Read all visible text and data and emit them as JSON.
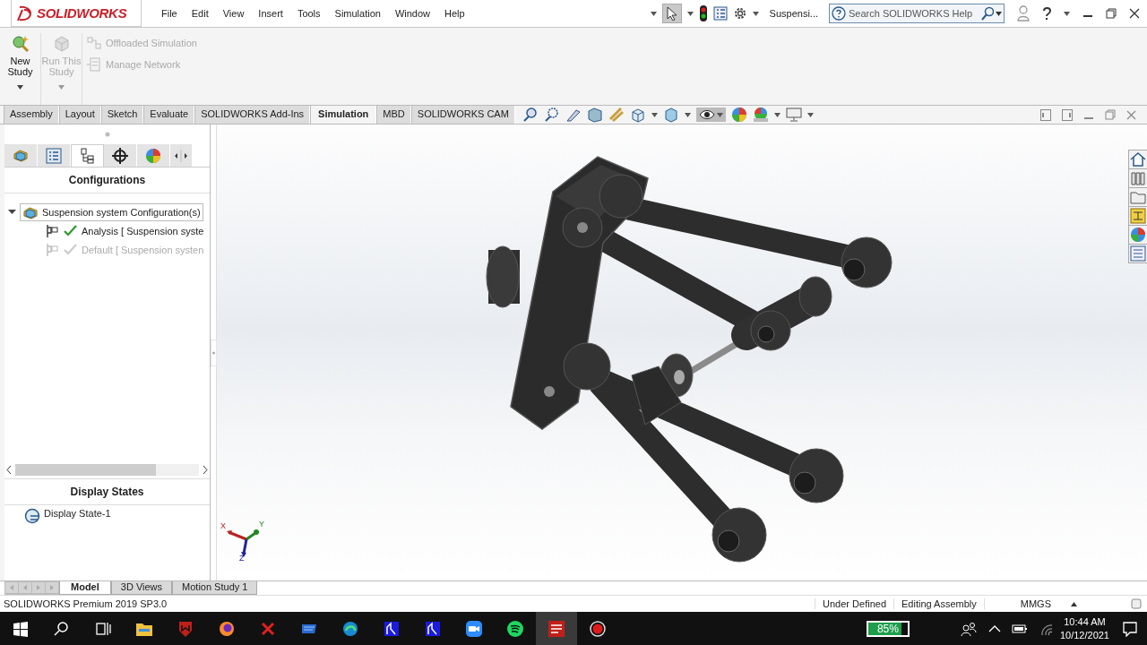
{
  "app": {
    "logo": "SOLIDWORKS"
  },
  "menu": [
    "File",
    "Edit",
    "View",
    "Insert",
    "Tools",
    "Simulation",
    "Window",
    "Help"
  ],
  "document_title": "Suspensi...",
  "search": {
    "placeholder": "Search SOLIDWORKS Help"
  },
  "ribbon": {
    "large_buttons": [
      {
        "label": "New Study",
        "disabled": false
      },
      {
        "label": "Run This Study",
        "disabled": true
      }
    ],
    "small_buttons": [
      {
        "label": "Offloaded Simulation",
        "disabled": true
      },
      {
        "label": "Manage Network",
        "disabled": true
      }
    ]
  },
  "command_tabs": [
    {
      "label": "Assembly",
      "selected": false
    },
    {
      "label": "Layout",
      "selected": false
    },
    {
      "label": "Sketch",
      "selected": false
    },
    {
      "label": "Evaluate",
      "selected": false
    },
    {
      "label": "SOLIDWORKS Add-Ins",
      "selected": false
    },
    {
      "label": "Simulation",
      "selected": true
    },
    {
      "label": "MBD",
      "selected": false
    },
    {
      "label": "SOLIDWORKS CAM",
      "selected": false
    }
  ],
  "panel_tabs": [
    {
      "selected": false
    },
    {
      "selected": false
    },
    {
      "selected": true
    },
    {
      "selected": false
    },
    {
      "selected": false
    }
  ],
  "configurations": {
    "title": "Configurations",
    "tree": [
      {
        "label": "Suspension system Configuration(s)",
        "expanded": true,
        "children": [
          {
            "label": "Analysis [ Suspension syste",
            "active": true
          },
          {
            "label": "Default [ Suspension systen",
            "active": false
          }
        ]
      }
    ]
  },
  "display_states": {
    "title": "Display States",
    "items": [
      "Display State-1"
    ]
  },
  "triad": {
    "x": "X",
    "y": "Y",
    "z": "Z"
  },
  "bottom_tabs": [
    {
      "label": "Model",
      "selected": true
    },
    {
      "label": "3D Views",
      "selected": false
    },
    {
      "label": "Motion Study 1",
      "selected": false
    }
  ],
  "status_bar": {
    "product": "SOLIDWORKS Premium 2019 SP3.0",
    "fields": [
      "Under Defined",
      "Editing Assembly",
      "MMGS"
    ]
  },
  "taskbar": {
    "battery": {
      "label": "85%",
      "level": 0.85
    },
    "time": "10:44 AM",
    "date": "10/12/2021"
  }
}
